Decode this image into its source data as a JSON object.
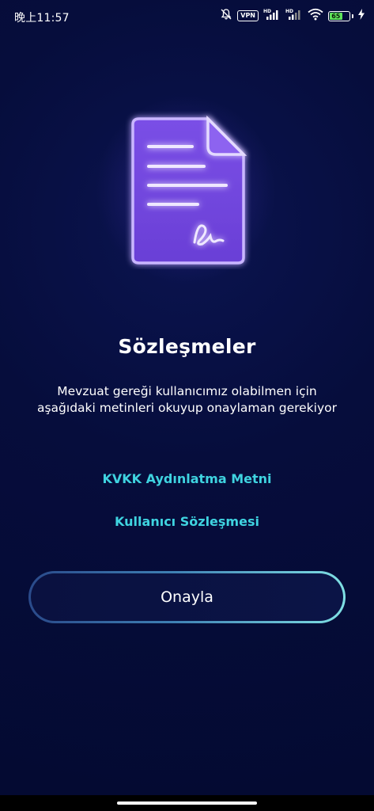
{
  "status_bar": {
    "time": "晚上11:57",
    "vpn": "VPN",
    "battery_level": "65",
    "icons": [
      "mute-bell-icon",
      "vpn-badge",
      "signal-hd-icon",
      "signal-hd-icon",
      "wifi-icon",
      "battery-icon",
      "charging-bolt-icon"
    ]
  },
  "illustration": {
    "icon": "signed-document-icon",
    "accent": "#8b5cf6"
  },
  "content": {
    "title": "Sözleşmeler",
    "description": "Mevzuat gereği kullanıcımız olabilmen için aşağıdaki metinleri okuyup onaylaman gerekiyor",
    "links": {
      "kvkk": "KVKK Aydınlatma Metni",
      "user_agreement": "Kullanıcı Sözleşmesi"
    },
    "approve_label": "Onayla"
  },
  "colors": {
    "background": "#050c36",
    "link": "#3fd3e0",
    "button_border_start": "#2a4a8a",
    "button_border_end": "#7fe0e4"
  }
}
